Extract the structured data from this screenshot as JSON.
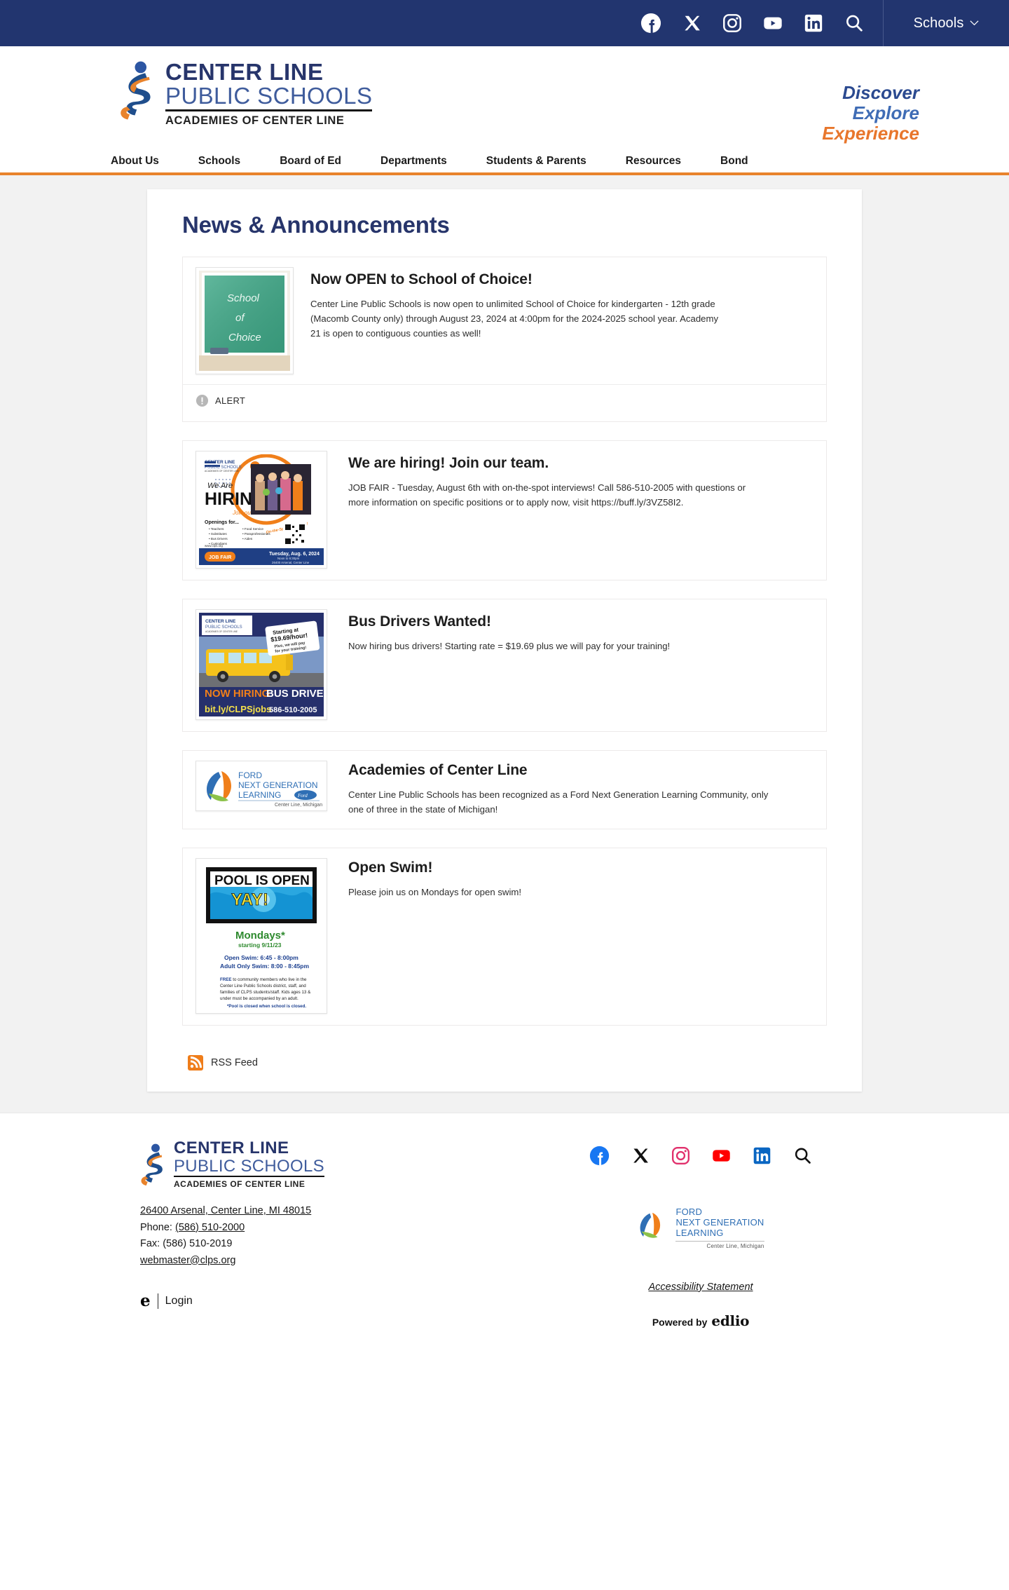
{
  "topbar": {
    "social": [
      {
        "name": "facebook-icon",
        "label": "Facebook"
      },
      {
        "name": "x-twitter-icon",
        "label": "X"
      },
      {
        "name": "instagram-icon",
        "label": "Instagram"
      },
      {
        "name": "youtube-icon",
        "label": "YouTube"
      },
      {
        "name": "linkedin-icon",
        "label": "LinkedIn"
      },
      {
        "name": "search-icon",
        "label": "Search"
      }
    ],
    "schools_button": "Schools"
  },
  "header": {
    "logo_line1": "CENTER LINE",
    "logo_line2": "PUBLIC SCHOOLS",
    "logo_line3": "ACADEMIES OF CENTER LINE",
    "tagline1": "Discover",
    "tagline2": "Explore",
    "tagline3": "Experience"
  },
  "nav": {
    "items": [
      "About Us",
      "Schools",
      "Board of Ed",
      "Departments",
      "Students & Parents",
      "Resources",
      "Bond"
    ]
  },
  "main": {
    "page_title": "News & Announcements",
    "rss_label": "RSS Feed",
    "items": [
      {
        "title": "Now OPEN to School of Choice!",
        "description": "Center Line Public Schools is now open to unlimited School of Choice for kindergarten - 12th grade (Macomb County only) through August 23, 2024 at 4:00pm for the 2024-2025 school year. Academy 21 is open to contiguous counties as well!",
        "thumb": "school-of-choice-chalkboard",
        "thumb_text": [
          "School",
          "of",
          "Choice"
        ],
        "alert_label": "ALERT",
        "has_alert": true
      },
      {
        "title": "We are hiring! Join our team.",
        "description": "JOB FAIR - Tuesday, August 6th with on-the-spot interviews! Call 586-510-2005 with questions or more information on specific positions or to apply now, visit https://buff.ly/3VZ58I2.",
        "thumb": "hiring-job-fair-flyer",
        "has_alert": false
      },
      {
        "title": "Bus Drivers Wanted!",
        "description": "Now hiring bus drivers! Starting rate = $19.69 plus we will pay for your training!",
        "thumb": "bus-drivers-flyer",
        "has_alert": false
      },
      {
        "title": "Academies of Center Line",
        "description": "Center Line Public Schools has been recognized as a Ford Next Generation Learning Community, only one of three in the state of Michigan!",
        "thumb": "ford-next-generation-learning-logo",
        "has_alert": false
      },
      {
        "title": "Open Swim!",
        "description": "Please join us on Mondays for open swim!",
        "thumb": "pool-is-open-flyer",
        "has_alert": false
      }
    ],
    "flyers": {
      "hiring": {
        "brand1": "CENTER LINE",
        "brand2": "PUBLIC SCHOOLS",
        "we_are": "We Are",
        "hiring": "HIRING!",
        "join": "Join our team!",
        "openings": "Openings for...",
        "col1": [
          "Teachers",
          "Substitutes",
          "Bus Drivers",
          "Custodians"
        ],
        "col2": [
          "Food Service",
          "Parapros",
          "Aides"
        ],
        "onthespot": "On-the-Spot Interviews!",
        "jobfair": "JOB FAIR",
        "date": "Tuesday, Aug. 6, 2024",
        "time": "Noon to 6:30pm",
        "address": "26400 Arsenal, Center Line",
        "site": "www.clps.org"
      },
      "bus": {
        "brand1": "CENTER LINE",
        "brand2": "PUBLIC SCHOOLS",
        "badge1": "Starting at",
        "badge2": "$19.69/hour!",
        "badge3": "Plus, we will pay",
        "badge4": "for your training!",
        "headline1": "NOW HIRING",
        "headline2": "BUS DRIVERS",
        "url": "bit.ly/CLPSjobs",
        "phone": "586-510-2005"
      },
      "ford": {
        "line1": "FORD",
        "line2": "NEXT GENERATION",
        "line3": "LEARNING",
        "sub": "Center Line, Michigan"
      },
      "pool": {
        "title": "POOL IS OPEN",
        "yay": "YAY!",
        "days": "Mondays*",
        "starting": "starting 9/11/23",
        "open_swim": "Open Swim:  6:45 - 8:00pm",
        "adult_swim": "Adult Only Swim:  8:00 - 8:45pm",
        "free_note": "FREE to community members who live in the Center Line Public Schools district, staff, and families of CLPS students/staff.  Kids ages 13 & under must be accompanied by an adult.",
        "footnote": "*Pool is closed when school is closed."
      }
    }
  },
  "footer": {
    "logo_line1": "CENTER LINE",
    "logo_line2": "PUBLIC SCHOOLS",
    "logo_line3": "ACADEMIES OF CENTER LINE",
    "address": "26400 Arsenal, Center Line, MI 48015",
    "phone_label": "Phone: ",
    "phone": "(586) 510-2000",
    "fax": "Fax: (586) 510-2019",
    "email": "webmaster@clps.org",
    "login": "Login",
    "edlio_e": "e",
    "social": [
      {
        "name": "facebook-icon",
        "label": "Facebook"
      },
      {
        "name": "x-twitter-icon",
        "label": "X"
      },
      {
        "name": "instagram-icon",
        "label": "Instagram"
      },
      {
        "name": "youtube-icon",
        "label": "YouTube"
      },
      {
        "name": "linkedin-icon",
        "label": "LinkedIn"
      },
      {
        "name": "search-icon",
        "label": "Search"
      }
    ],
    "fng_line1": "FORD",
    "fng_line2": "NEXT GENERATION",
    "fng_line3": "LEARNING",
    "fng_sub": "Center Line, Michigan",
    "accessibility": "Accessibility Statement",
    "powered_by": "Powered by",
    "edlio": "edlio"
  },
  "colors": {
    "navy": "#22356f",
    "orange": "#e8832c",
    "title_navy": "#27356b",
    "page_bg": "#f2f2f2"
  }
}
